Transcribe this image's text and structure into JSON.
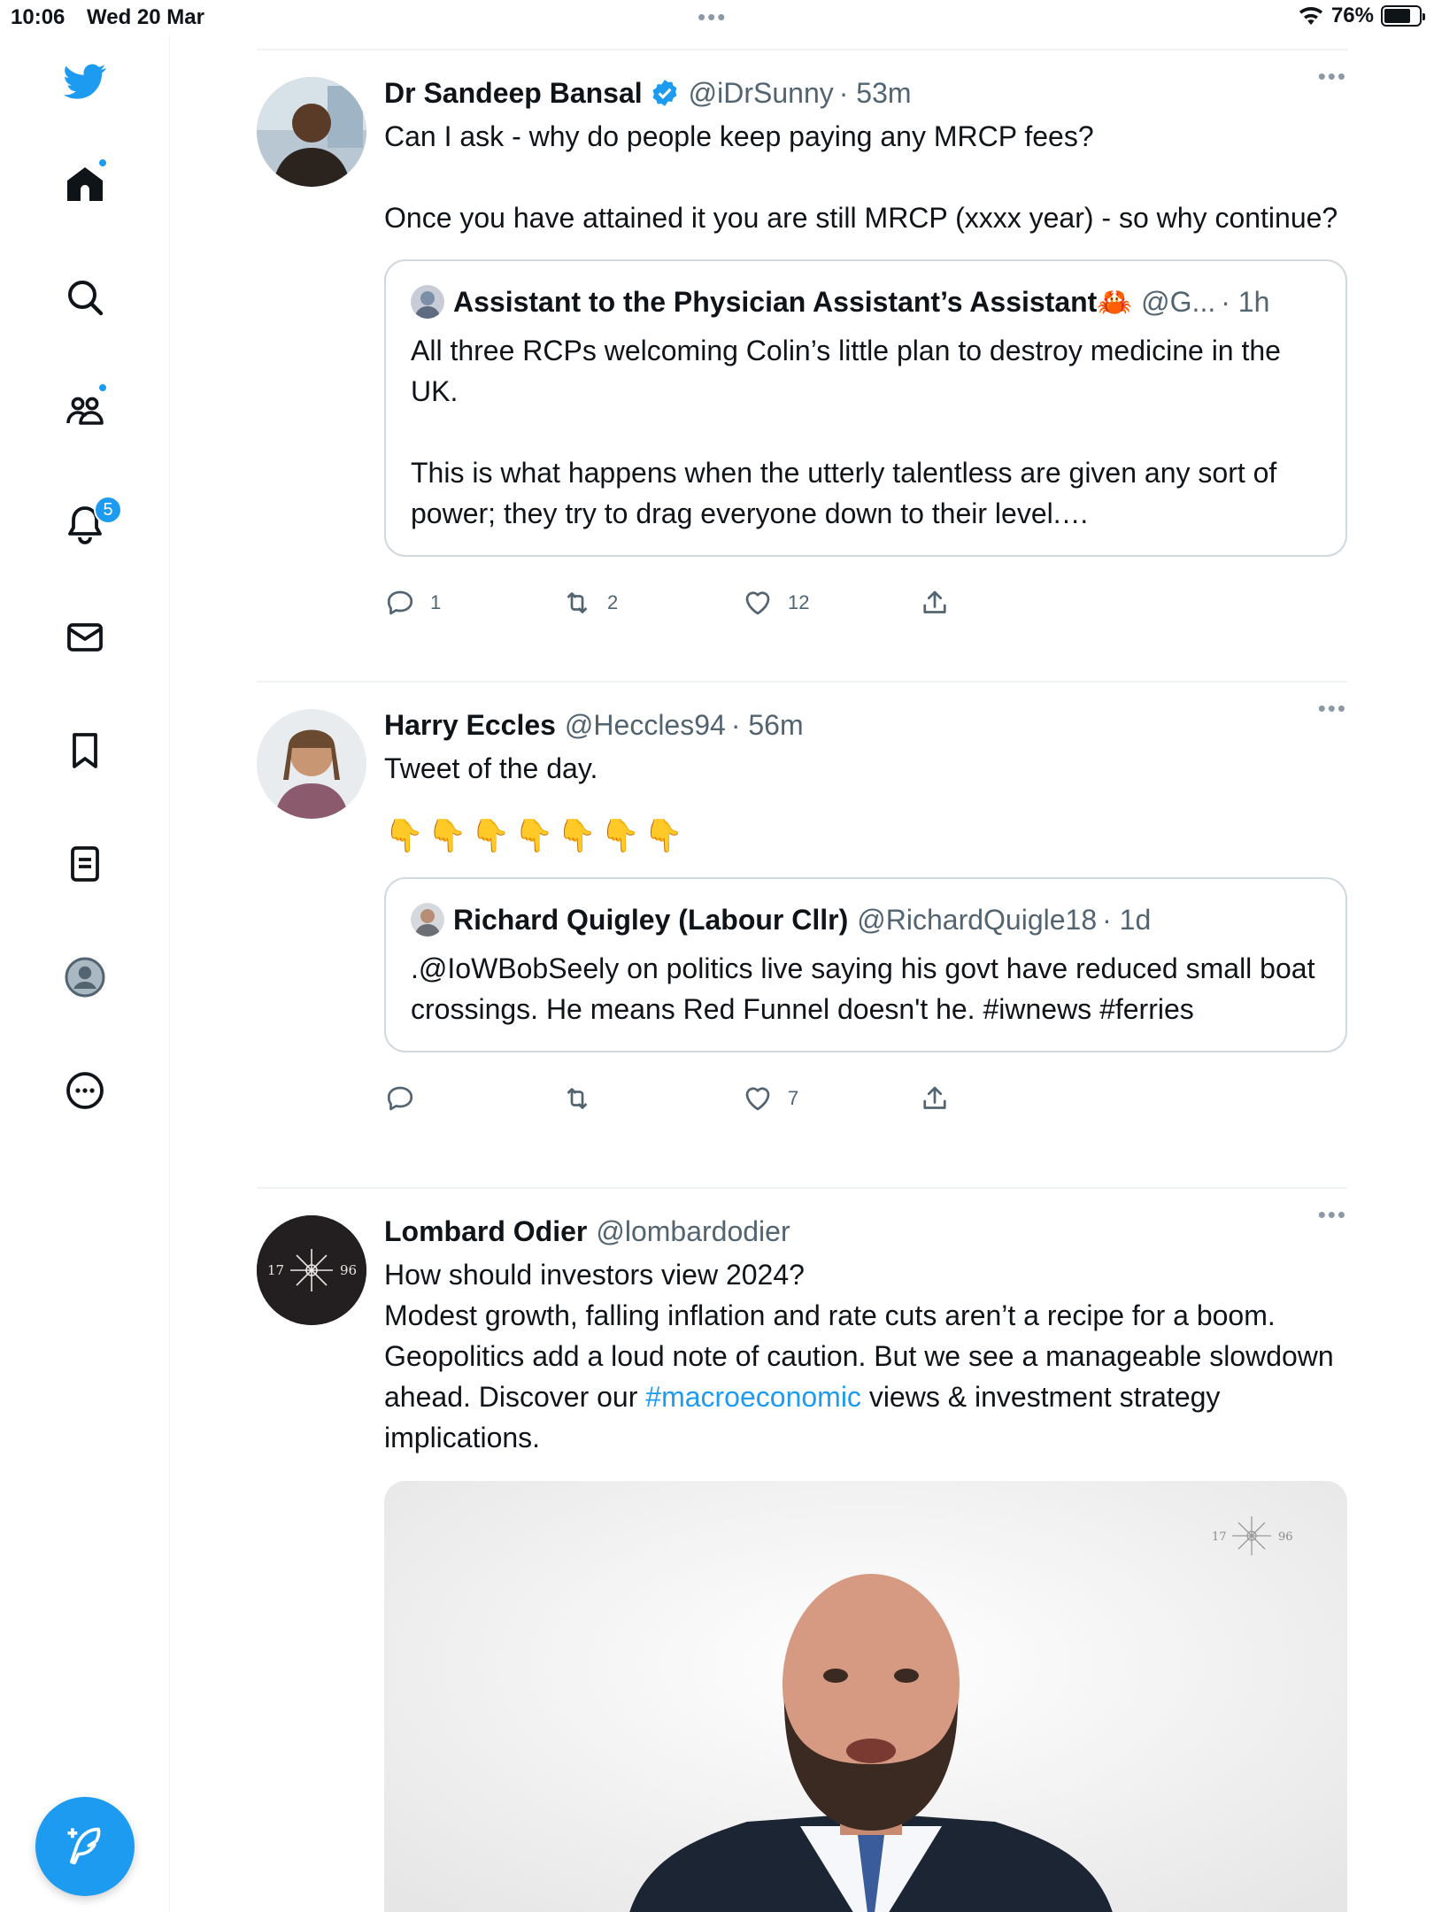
{
  "status_bar": {
    "time": "10:06",
    "date": "Wed 20 Mar",
    "battery": "76%",
    "battery_level": 0.76
  },
  "sidebar": {
    "items": [
      {
        "name": "twitter-logo"
      },
      {
        "name": "home",
        "has_dot": true
      },
      {
        "name": "explore"
      },
      {
        "name": "communities",
        "has_dot": true
      },
      {
        "name": "notifications",
        "badge": "5"
      },
      {
        "name": "messages"
      },
      {
        "name": "bookmarks"
      },
      {
        "name": "lists"
      },
      {
        "name": "profile"
      },
      {
        "name": "more"
      }
    ]
  },
  "tweets": [
    {
      "name": "Dr Sandeep Bansal",
      "verified": true,
      "handle": "@iDrSunny",
      "time": "· 53m",
      "text": "Can I ask - why do people keep paying any MRCP fees?\n\nOnce you have attained it you are still MRCP (xxxx year) - so why continue?",
      "quote": {
        "name": "Assistant to the Physician Assistant’s Assistant🦀",
        "handle": "@G...",
        "time": "· 1h",
        "text": "All three RCPs welcoming Colin’s little plan to destroy medicine in the UK.\n\nThis is what happens when the utterly talentless are given any sort of power; they try to drag everyone down to their level.…"
      },
      "replies": "1",
      "retweets": "2",
      "likes": "12"
    },
    {
      "name": "Harry Eccles",
      "handle": "@Heccles94",
      "time": "· 56m",
      "text": "Tweet of the day.",
      "emojis": "👇👇👇👇👇👇👇",
      "quote": {
        "name": "Richard Quigley (Labour Cllr)",
        "handle": "@RichardQuigle18",
        "time": "· 1d",
        "text": ".@IoWBobSeely on politics live saying his govt have reduced small boat crossings.  He means Red Funnel doesn't he. #iwnews #ferries"
      },
      "replies": "",
      "retweets": "",
      "likes": "7"
    },
    {
      "name": "Lombard Odier",
      "handle": "@lombardodier",
      "time": "",
      "text_before": "How should investors view 2024?\nModest growth, falling inflation and rate cuts aren’t a recipe for a boom. Geopolitics add a loud note of caution. But we see a manageable slowdown ahead. Discover our ",
      "hashtag": "#macroeconomic",
      "text_after": " views & investment strategy implications.",
      "logo_left": "17",
      "logo_right": "96"
    }
  ],
  "colors": {
    "accent": "#1d9bf0",
    "text": "#0f1419",
    "secondary": "#536471",
    "border": "#cfd9de"
  }
}
